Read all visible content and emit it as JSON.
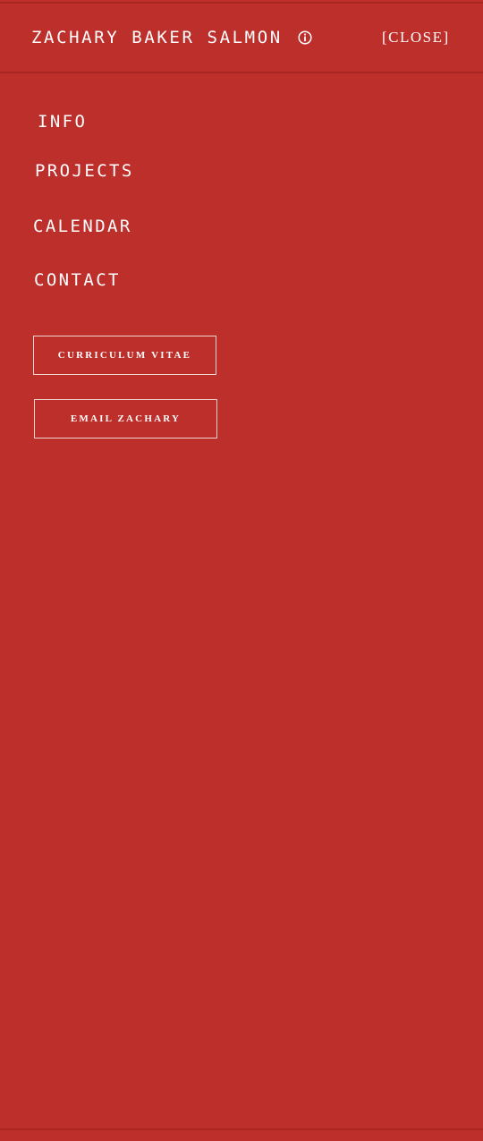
{
  "colors": {
    "background": "#bd2f2b",
    "rule": "#a82622",
    "text": "#ffffff"
  },
  "header": {
    "title": "ZACHARY BAKER SALMON",
    "info_icon": "info-circle-icon",
    "close_label": "[CLOSE]"
  },
  "nav": {
    "items": [
      {
        "label": "INFO"
      },
      {
        "label": "PROJECTS"
      },
      {
        "label": "CALENDAR"
      },
      {
        "label": "CONTACT"
      }
    ]
  },
  "buttons": {
    "cv_label": "CURRICULUM VITAE",
    "email_label": "EMAIL ZACHARY"
  }
}
